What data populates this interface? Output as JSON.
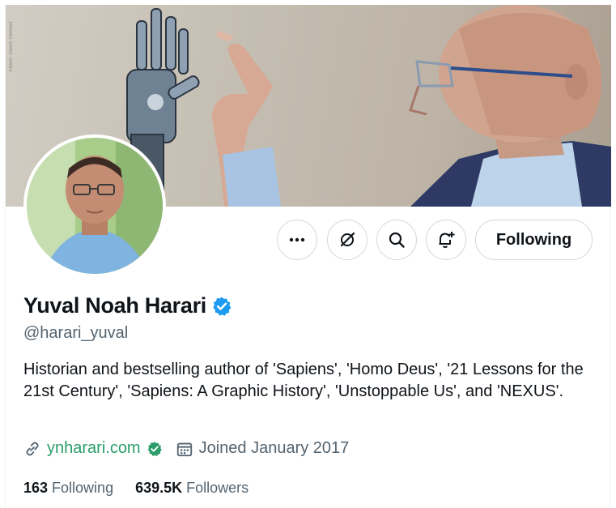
{
  "banner": {
    "photo_credit": "Photo: David Vintiner"
  },
  "actions": {
    "more_icon": "more-horizontal-icon",
    "grok_icon": "grok-icon",
    "search_icon": "search-icon",
    "notify_icon": "bell-plus-icon",
    "follow_label": "Following"
  },
  "profile": {
    "name": "Yuval Noah Harari",
    "verified_icon": "verified-badge-icon",
    "handle": "@harari_yuval",
    "bio": "Historian and bestselling author of 'Sapiens', 'Homo Deus', '21 Lessons for the 21st Century', 'Sapiens: A Graphic History', 'Unstoppable Us', and 'NEXUS'.",
    "website": "ynharari.com",
    "joined": "Joined January 2017"
  },
  "stats": {
    "following_count": "163",
    "following_label": "Following",
    "followers_count": "639.5K",
    "followers_label": "Followers"
  },
  "colors": {
    "verified_blue": "#1d9bf0",
    "link_green": "#2a9d6b",
    "secondary_text": "#536471",
    "border": "#cfd9de"
  }
}
